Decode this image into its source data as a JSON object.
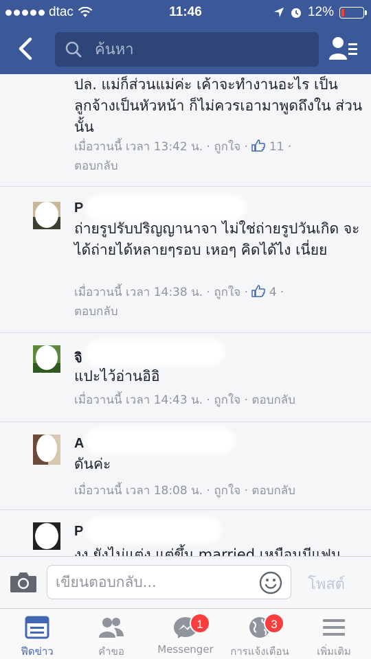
{
  "status_bar": {
    "carrier": "dtac",
    "time": "11:46",
    "battery": "12%",
    "battery_level": 0.12
  },
  "nav": {
    "search_placeholder": "ค้นหา"
  },
  "comments": [
    {
      "name": "",
      "text": "ปล. แม่ก็ส่วนแม่ค่ะ เค้าจะทำงานอะไร เป็น ลูกจ้างเป็นหัวหน้า ก็ไม่ควรเอามาพูดถึงใน ส่วนนั้น",
      "time": "เมื่อวานนี้ เวลา 13:42 น.",
      "like_label": "ถูกใจ",
      "like_count": "11",
      "reply_label": "ตอบกลับ"
    },
    {
      "name": "P",
      "text": "ถ่ายรูปรับปริญญานาจา ไม่ใช่ถ่ายรูปวันเกิด จะได้ถ่ายได้หลายๆรอบ เหอๆ คิดได้ไง เนี่ยย",
      "time": "เมื่อวานนี้ เวลา 14:38 น.",
      "like_label": "ถูกใจ",
      "like_count": "4",
      "reply_label": "ตอบกลับ"
    },
    {
      "name": "จิ",
      "text": "แปะไว้อ่านอิอิ",
      "time": "เมื่อวานนี้ เวลา 14:43 น.",
      "like_label": "ถูกใจ",
      "reply_label": "ตอบกลับ"
    },
    {
      "name": "A",
      "text": "ดันค่ะ",
      "time": "เมื่อวานนี้ เวลา 18:08 น.",
      "like_label": "ถูกใจ",
      "reply_label": "ตอบกลับ"
    },
    {
      "name": "P",
      "text": "งง ยังไม่แต่ง แต่ขึ้น married เหมือนมีแฟน",
      "time": "",
      "like_label": "",
      "reply_label": ""
    }
  ],
  "composer": {
    "placeholder": "เขียนตอบกลับ...",
    "post_label": "โพสต์"
  },
  "tabs": [
    {
      "label": "ฟีดข่าว",
      "icon": "news-feed-icon",
      "active": true
    },
    {
      "label": "คำขอ",
      "icon": "friend-requests-icon"
    },
    {
      "label": "Messenger",
      "icon": "messenger-icon",
      "badge": "1"
    },
    {
      "label": "การแจ้งเตือน",
      "icon": "globe-icon",
      "badge": "3"
    },
    {
      "label": "เพิ่มเติม",
      "icon": "menu-icon"
    }
  ],
  "colors": {
    "brand": "#3b5998",
    "badge": "#fa3e3e",
    "meta": "#90949c",
    "active_tab": "#4267b2"
  }
}
